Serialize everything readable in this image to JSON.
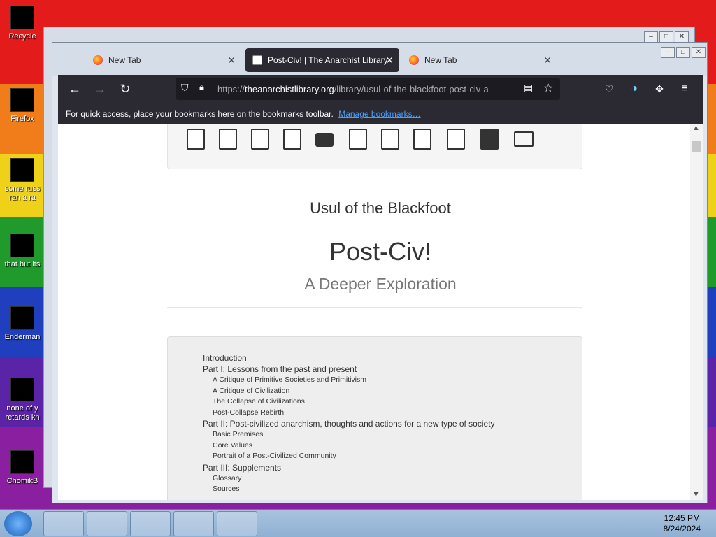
{
  "desktop": {
    "icons": [
      {
        "label": "Recycle"
      },
      {
        "label": "Firefox"
      },
      {
        "label": "some russ"
      },
      {
        "label": "ran a ra"
      },
      {
        "label": "that but its"
      },
      {
        "label": "Enderman"
      },
      {
        "label": "none of y"
      },
      {
        "label": "retards kn"
      },
      {
        "label": "ChomikB"
      }
    ]
  },
  "browser": {
    "tabs": [
      {
        "label": "New Tab"
      },
      {
        "label": "Post-Civ! | The Anarchist Library"
      },
      {
        "label": "New Tab"
      }
    ],
    "url": {
      "prefix": "https://",
      "host": "theanarchistlibrary.org",
      "path": "/library/usul-of-the-blackfoot-post-civ-a"
    },
    "bookmarks_bar": {
      "text": "For quick access, place your bookmarks here on the bookmarks toolbar.",
      "link": "Manage bookmarks…"
    }
  },
  "page": {
    "format_icons": [
      "pdf-icon",
      "pdf-icon",
      "pdf-icon",
      "epub-icon",
      "print-icon",
      "html-icon",
      "text-icon",
      "zip-icon",
      "edit-icon",
      "book-icon",
      "list-icon"
    ],
    "author": "Usul of the Blackfoot",
    "title": "Post-Civ!",
    "subtitle": "A Deeper Exploration",
    "toc": [
      {
        "level": 1,
        "text": "Introduction"
      },
      {
        "level": 1,
        "text": "Part I: Lessons from the past and present"
      },
      {
        "level": 2,
        "text": "A Critique of Primitive Societies and Primitivism"
      },
      {
        "level": 2,
        "text": "A Critique of Civilization"
      },
      {
        "level": 2,
        "text": "The Collapse of Civilizations"
      },
      {
        "level": 2,
        "text": "Post-Collapse Rebirth"
      },
      {
        "level": 1,
        "text": "Part II: Post-civilized anarchism, thoughts and actions for a new type of society"
      },
      {
        "level": 2,
        "text": "Basic Premises"
      },
      {
        "level": 2,
        "text": "Core Values"
      },
      {
        "level": 2,
        "text": "Portrait of a Post-Civilized Community"
      },
      {
        "level": 1,
        "text": "Part III: Supplements"
      },
      {
        "level": 2,
        "text": "Glossary"
      },
      {
        "level": 2,
        "text": "Sources"
      }
    ]
  },
  "taskbar": {
    "time": "12:45 PM",
    "date": "8/24/2024"
  }
}
